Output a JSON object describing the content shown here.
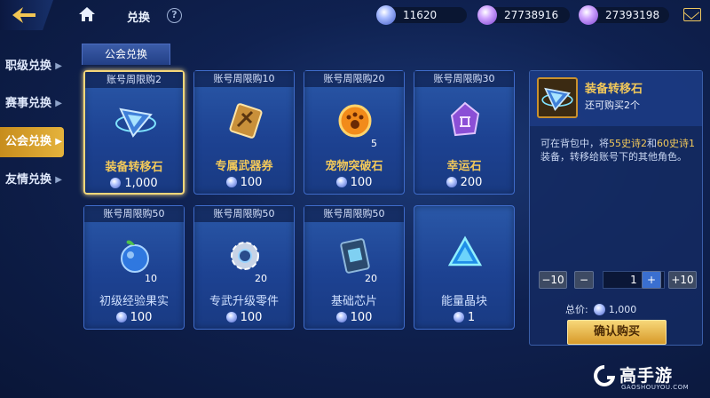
{
  "header": {
    "title": "兑换",
    "help_icon": "?",
    "currencies": [
      {
        "icon": "gem-icon",
        "value": "11620",
        "color": "#8fa6ff"
      },
      {
        "icon": "purple-crystal-icon",
        "value": "27738916",
        "color": "#b47dff"
      },
      {
        "icon": "purple-crystal-icon",
        "value": "27393198",
        "color": "#b47dff"
      }
    ]
  },
  "sidebar": {
    "items": [
      {
        "label": "职级兑换",
        "active": false
      },
      {
        "label": "赛事兑换",
        "active": false
      },
      {
        "label": "公会兑换",
        "active": true
      },
      {
        "label": "友情兑换",
        "active": false
      }
    ]
  },
  "tab": {
    "label": "公会兑换"
  },
  "items": [
    {
      "limit": "账号周限购2",
      "name": "装备转移石",
      "price": "1,000",
      "qty": "",
      "selected": true,
      "icon": "transfer-stone-icon"
    },
    {
      "limit": "账号周限购10",
      "name": "专属武器券",
      "price": "100",
      "qty": "",
      "selected": false,
      "icon": "weapon-ticket-icon"
    },
    {
      "limit": "账号周限购20",
      "name": "宠物突破石",
      "price": "100",
      "qty": "5",
      "selected": false,
      "icon": "pet-stone-icon"
    },
    {
      "limit": "账号周限购30",
      "name": "幸运石",
      "price": "200",
      "qty": "",
      "selected": false,
      "icon": "lucky-stone-icon"
    },
    {
      "limit": "账号周限购50",
      "name": "初级经验果实",
      "price": "100",
      "qty": "10",
      "selected": false,
      "icon": "exp-fruit-icon"
    },
    {
      "limit": "账号周限购50",
      "name": "专武升级零件",
      "price": "100",
      "qty": "20",
      "selected": false,
      "icon": "gear-part-icon"
    },
    {
      "limit": "账号周限购50",
      "name": "基础芯片",
      "price": "100",
      "qty": "20",
      "selected": false,
      "icon": "chip-icon"
    },
    {
      "limit": "",
      "name": "能量晶块",
      "price": "1",
      "qty": "",
      "selected": false,
      "icon": "energy-crystal-icon"
    }
  ],
  "detail": {
    "name": "装备转移石",
    "remaining": "还可购买2个",
    "desc_prefix": "可在背包中，将",
    "desc_hl1": "55史诗2",
    "desc_mid1": "和",
    "desc_hl2": "60史诗1",
    "desc_suffix": "装备，转移给账号下的其他角色。",
    "btn_minus10": "−10",
    "btn_minus": "−",
    "quantity": "1",
    "btn_plus": "+",
    "btn_plus10": "+10",
    "total_label": "总价:",
    "total_value": "1,000",
    "buy_label": "确认购买"
  },
  "watermark": {
    "text": "高手游",
    "url": "GAOSHOUYOU.COM"
  }
}
